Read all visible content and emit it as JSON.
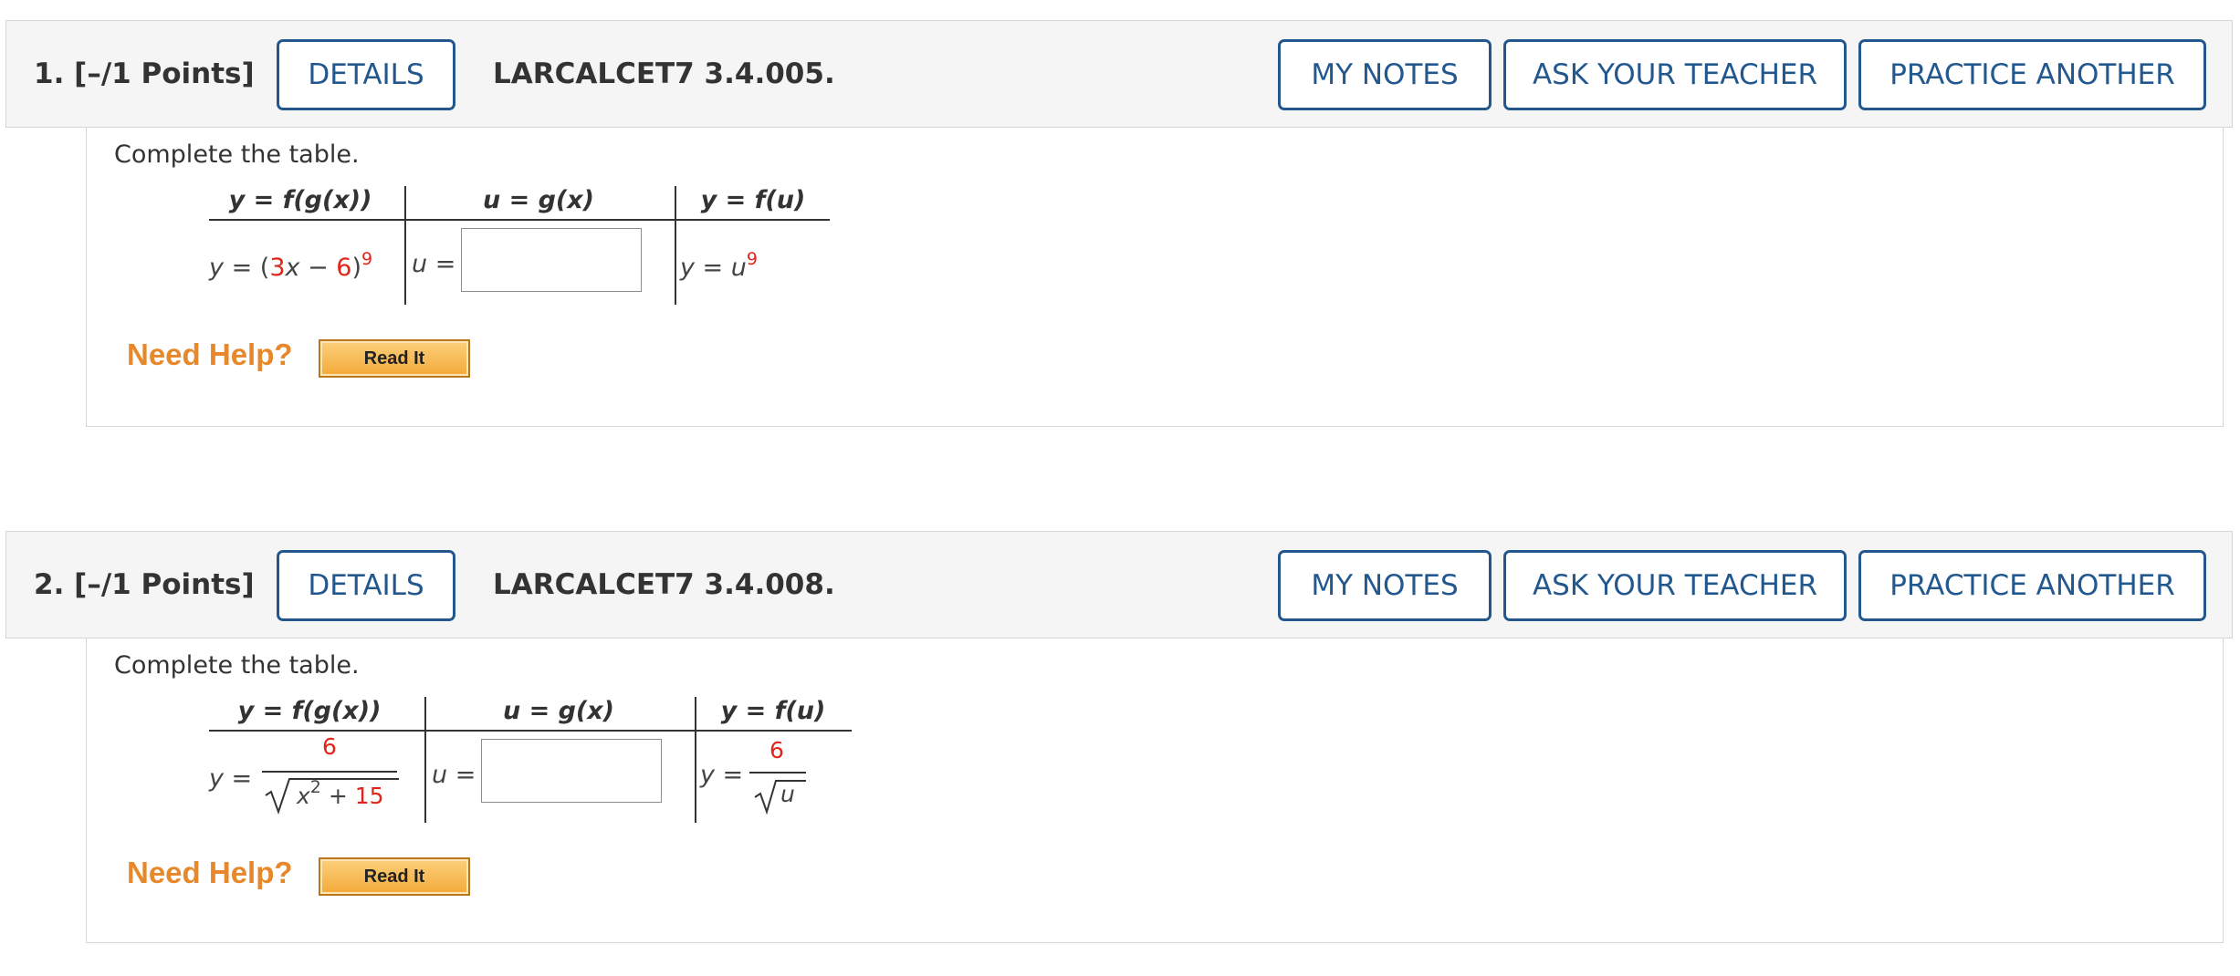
{
  "questions": [
    {
      "number_label": "1.",
      "points_label": "[–/1 Points]",
      "details_label": "DETAILS",
      "code": "LARCALCET7 3.4.005.",
      "my_notes_label": "MY NOTES",
      "ask_teacher_label": "ASK YOUR TEACHER",
      "practice_label": "PRACTICE ANOTHER",
      "prompt": "Complete the table.",
      "table": {
        "headers": [
          "y = f(g(x))",
          "u = g(x)",
          "y = f(u)"
        ],
        "col1": {
          "prefix": "y = (",
          "coef": "3",
          "mid": "x − ",
          "const": "6",
          "close": ")",
          "exp": "9"
        },
        "col2_prefix": "u =",
        "col3": {
          "prefix": "y = u",
          "exp": "9"
        }
      },
      "help_label": "Need Help?",
      "read_it_label": "Read It"
    },
    {
      "number_label": "2.",
      "points_label": "[–/1 Points]",
      "details_label": "DETAILS",
      "code": "LARCALCET7 3.4.008.",
      "my_notes_label": "MY NOTES",
      "ask_teacher_label": "ASK YOUR TEACHER",
      "practice_label": "PRACTICE ANOTHER",
      "prompt": "Complete the table.",
      "table": {
        "headers": [
          "y = f(g(x))",
          "u = g(x)",
          "y = f(u)"
        ],
        "col1": {
          "prefix": "y =",
          "numerator": "6",
          "radicand_var": "x",
          "radicand_exp": "2",
          "radicand_op": " + ",
          "radicand_const": "15"
        },
        "col2_prefix": "u =",
        "col3": {
          "prefix": "y =",
          "numerator": "6",
          "radicand": "u"
        }
      },
      "help_label": "Need Help?",
      "read_it_label": "Read It"
    }
  ]
}
